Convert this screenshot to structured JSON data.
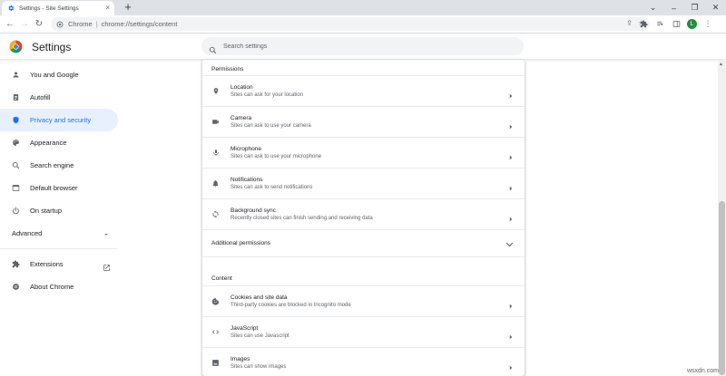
{
  "tab": {
    "title": "Settings - Site Settings"
  },
  "address_bar": {
    "scheme": "Chrome",
    "separator": "|",
    "url": "chrome://settings/content"
  },
  "profile": {
    "initial": "L"
  },
  "header": {
    "title": "Settings",
    "search_placeholder": "Search settings"
  },
  "sidebar": {
    "items": [
      {
        "label": "You and Google",
        "icon": "person-icon"
      },
      {
        "label": "Autofill",
        "icon": "clipboard-icon"
      },
      {
        "label": "Privacy and security",
        "icon": "shield-icon"
      },
      {
        "label": "Appearance",
        "icon": "palette-icon"
      },
      {
        "label": "Search engine",
        "icon": "search-icon"
      },
      {
        "label": "Default browser",
        "icon": "browser-icon"
      },
      {
        "label": "On startup",
        "icon": "power-icon"
      }
    ],
    "advanced_label": "Advanced",
    "extensions_label": "Extensions",
    "about_label": "About Chrome"
  },
  "permissions": {
    "section_title": "Permissions",
    "rows": [
      {
        "title": "Location",
        "subtitle": "Sites can ask for your location",
        "icon": "location-pin-icon"
      },
      {
        "title": "Camera",
        "subtitle": "Sites can ask to use your camera",
        "icon": "camera-icon"
      },
      {
        "title": "Microphone",
        "subtitle": "Sites can ask to use your microphone",
        "icon": "microphone-icon"
      },
      {
        "title": "Notifications",
        "subtitle": "Sites can ask to send notifications",
        "icon": "bell-icon"
      },
      {
        "title": "Background sync",
        "subtitle": "Recently closed sites can finish sending and receiving data",
        "icon": "sync-icon"
      }
    ],
    "additional_label": "Additional permissions"
  },
  "content": {
    "section_title": "Content",
    "rows": [
      {
        "title": "Cookies and site data",
        "subtitle": "Third-party cookies are blocked in Incognito mode",
        "icon": "cookie-icon"
      },
      {
        "title": "JavaScript",
        "subtitle": "Sites can use Javascript",
        "icon": "code-icon"
      },
      {
        "title": "Images",
        "subtitle": "Sites can show images",
        "icon": "image-icon"
      }
    ]
  },
  "watermark": "wsxdn.com",
  "colors": {
    "accent": "#1a73e8",
    "active_bg": "#e8f0fe",
    "text": "#202124",
    "muted": "#5f6368"
  }
}
